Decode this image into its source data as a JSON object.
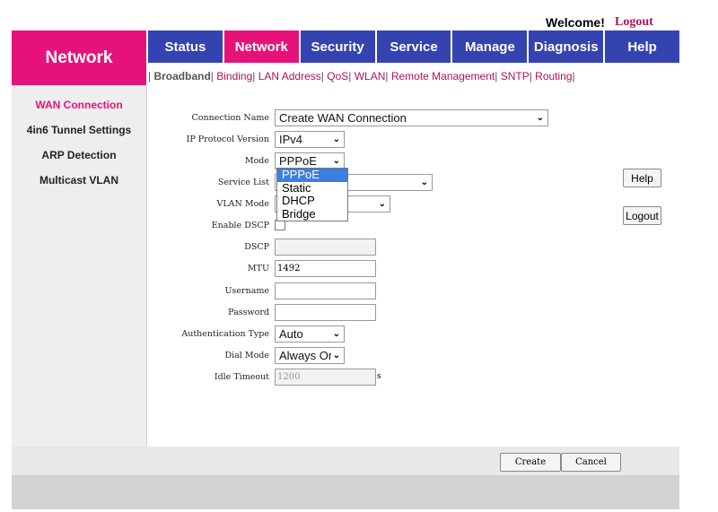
{
  "header": {
    "welcome": "Welcome!",
    "logout": "Logout",
    "brand": "Network"
  },
  "tabs": [
    "Status",
    "Network",
    "Security",
    "Service",
    "Manage",
    "Diagnosis",
    "Help"
  ],
  "subnav": [
    "Broadband",
    "Binding",
    "LAN Address",
    "QoS",
    "WLAN",
    "Remote Management",
    "SNTP",
    "Routing"
  ],
  "sidebar": [
    "WAN Connection",
    "4in6 Tunnel Settings",
    "ARP Detection",
    "Multicast VLAN"
  ],
  "form": {
    "connection_name": {
      "label": "Connection Name",
      "value": "Create WAN Connection"
    },
    "ip_version": {
      "label": "IP Protocol Version",
      "value": "IPv4"
    },
    "mode": {
      "label": "Mode",
      "value": "PPPoE",
      "options": [
        "PPPoE",
        "Static",
        "DHCP",
        "Bridge"
      ]
    },
    "service_list": {
      "label": "Service List",
      "value": ""
    },
    "vlan_mode": {
      "label": "VLAN Mode",
      "value": ""
    },
    "enable_dscp": {
      "label": "Enable DSCP"
    },
    "dscp": {
      "label": "DSCP",
      "value": ""
    },
    "mtu": {
      "label": "MTU",
      "value": "1492"
    },
    "username": {
      "label": "Username",
      "value": ""
    },
    "password": {
      "label": "Password",
      "value": ""
    },
    "auth_type": {
      "label": "Authentication Type",
      "value": "Auto"
    },
    "dial_mode": {
      "label": "Dial Mode",
      "value": "Always On"
    },
    "idle_timeout": {
      "label": "Idle Timeout",
      "value": "1200",
      "unit": "s"
    }
  },
  "side_buttons": {
    "help": "Help",
    "logout": "Logout"
  },
  "footer": {
    "create": "Create",
    "cancel": "Cancel"
  }
}
